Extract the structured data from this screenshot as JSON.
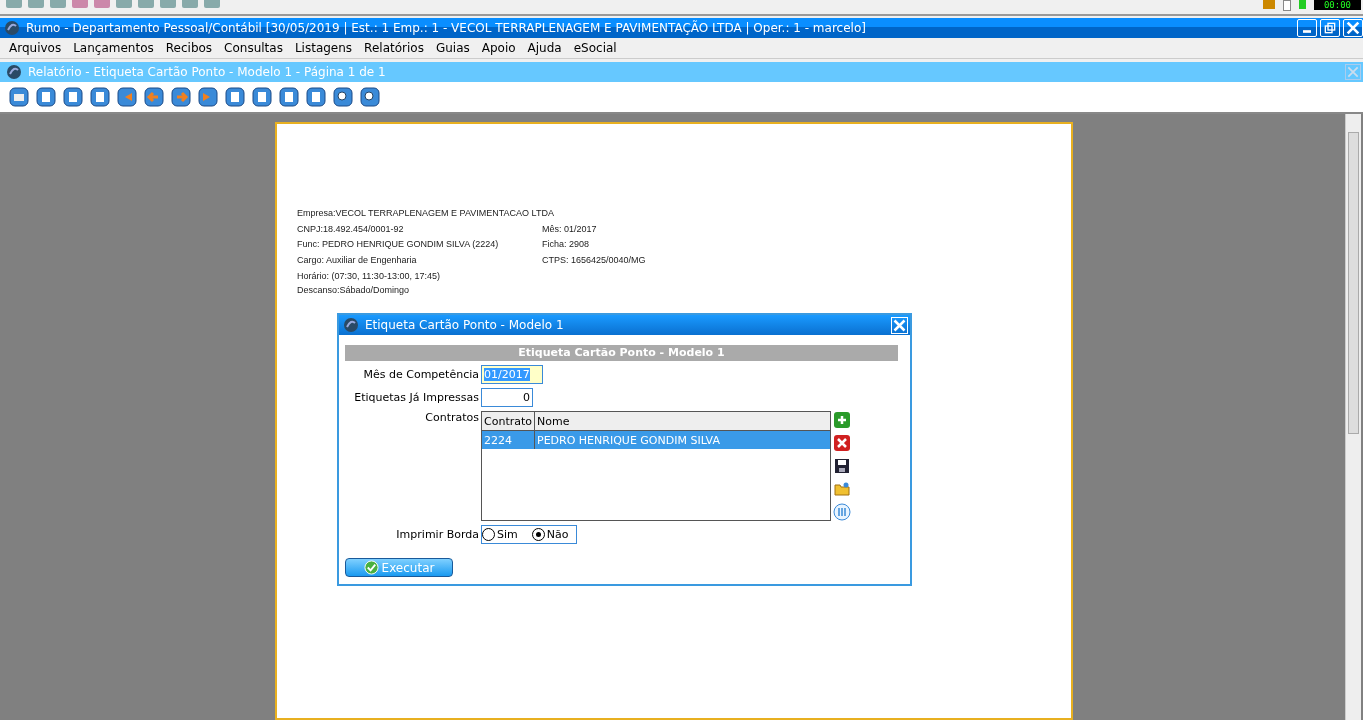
{
  "status_clock": "00:00",
  "window": {
    "title": "Rumo - Departamento Pessoal/Contábil [30/05/2019 | Est.: 1 Emp.: 1 - VECOL TERRAPLENAGEM E PAVIMENTAÇÃO LTDA | Oper.: 1 - marcelo]"
  },
  "menu": [
    "Arquivos",
    "Lançamentos",
    "Recibos",
    "Consultas",
    "Listagens",
    "Relatórios",
    "Guias",
    "Apoio",
    "Ajuda",
    "eSocial"
  ],
  "report_window": {
    "title": "Relatório - Etiqueta Cartão Ponto - Modelo 1 - Página 1 de 1"
  },
  "report_lines": [
    {
      "left": "Empresa:VECOL TERRAPLENAGEM E PAVIMENTACAO LTDA"
    },
    {
      "left": "CNPJ:18.492.454/0001-92",
      "right": "Mês: 01/2017"
    },
    {
      "left": "Func: PEDRO HENRIQUE GONDIM SILVA (2224)",
      "right": "Ficha: 2908"
    },
    {
      "left": "Cargo: Auxiliar de Engenharia",
      "right": "CTPS: 1656425/0040/MG"
    },
    {
      "left": "Horário: (07:30, 11:30-13:00, 17:45)"
    },
    {
      "left": "Descanso:Sábado/Domingo"
    }
  ],
  "dialog": {
    "title": "Etiqueta Cartão Ponto - Modelo 1",
    "header": "Etiqueta Cartão Ponto - Modelo 1",
    "month_label": "Mês de Competência",
    "month_value": "01/2017",
    "printed_label": "Etiquetas Já Impressas",
    "printed_value": "0",
    "contracts_label": "Contratos",
    "columns": [
      "Contrato",
      "Nome"
    ],
    "rows": [
      {
        "contract": "2224",
        "name": "PEDRO HENRIQUE GONDIM SILVA",
        "selected": true
      }
    ],
    "border_label": "Imprimir Borda",
    "border_options": [
      {
        "label": "Sim",
        "selected": false
      },
      {
        "label": "Não",
        "selected": true
      }
    ],
    "execute_button": "Executar"
  }
}
